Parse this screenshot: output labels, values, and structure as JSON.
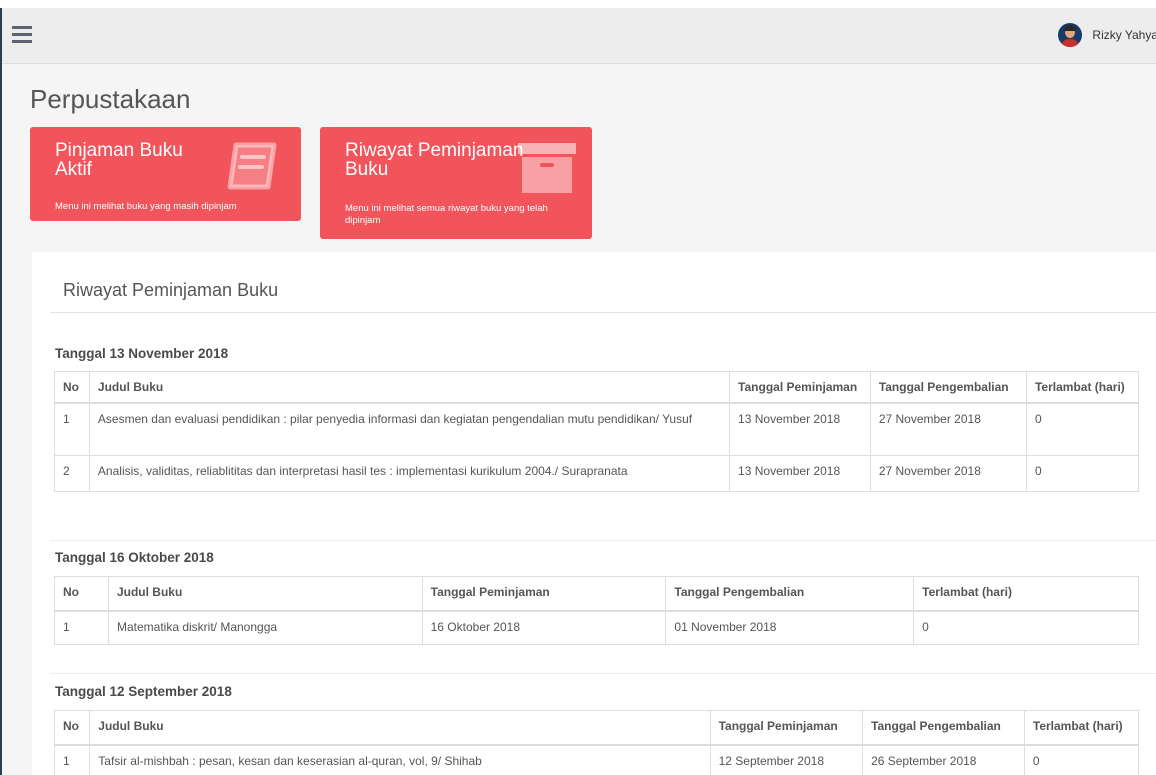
{
  "header": {
    "user_name": "Rizky Yahya"
  },
  "page": {
    "title": "Perpustakaan"
  },
  "tiles": [
    {
      "title": "Pinjaman Buku Aktif",
      "description": "Menu ini melihat buku yang masih dipinjam",
      "icon": "book-icon"
    },
    {
      "title": "Riwayat Peminjaman Buku",
      "description": "Menu ini melihat semua riwayat buku yang telah dipinjam",
      "icon": "archive-box-icon"
    }
  ],
  "panel": {
    "title": "Riwayat Peminjaman Buku"
  },
  "columns": {
    "no": "No",
    "judul": "Judul Buku",
    "tgl_pinjam": "Tanggal Peminjaman",
    "tgl_kembali": "Tanggal Pengembalian",
    "terlambat": "Terlambat (hari)"
  },
  "groups": [
    {
      "title": "Tanggal 13 November 2018",
      "rows": [
        {
          "no": "1",
          "judul": "Asesmen dan evaluasi pendidikan : pilar penyedia informasi dan kegiatan pengendalian mutu pendidikan/ Yusuf",
          "tgl_pinjam": "13 November 2018",
          "tgl_kembali": "27 November 2018",
          "terlambat": "0"
        },
        {
          "no": "2",
          "judul": "Analisis, validitas, reliablititas dan interpretasi hasil tes : implementasi kurikulum 2004./ Surapranata",
          "tgl_pinjam": "13 November 2018",
          "tgl_kembali": "27 November 2018",
          "terlambat": "0"
        }
      ]
    },
    {
      "title": "Tanggal 16 Oktober 2018",
      "rows": [
        {
          "no": "1",
          "judul": "Matematika diskrit/ Manongga",
          "tgl_pinjam": "16 Oktober 2018",
          "tgl_kembali": "01 November 2018",
          "terlambat": "0"
        }
      ]
    },
    {
      "title": "Tanggal 12 September 2018",
      "rows": [
        {
          "no": "1",
          "judul": "Tafsir al-mishbah : pesan, kesan dan keserasian al-quran, vol, 9/ Shihab",
          "tgl_pinjam": "12 September 2018",
          "tgl_kembali": "26 September 2018",
          "terlambat": "0"
        }
      ]
    }
  ]
}
